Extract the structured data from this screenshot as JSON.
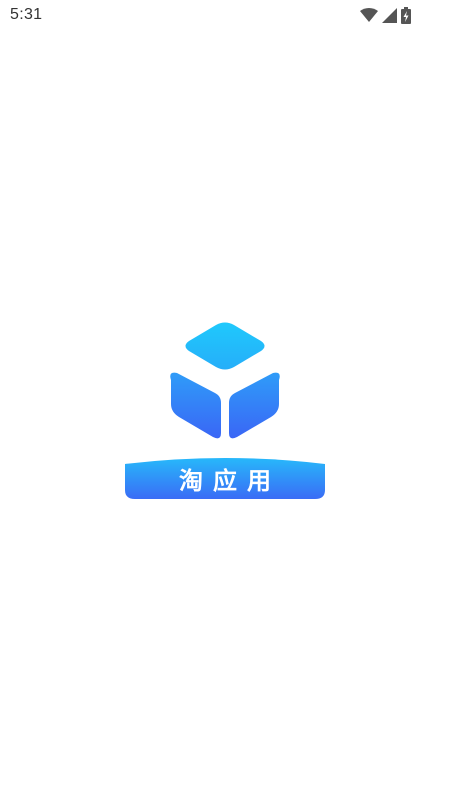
{
  "status_bar": {
    "time": "5:31",
    "icons": [
      "wifi-icon",
      "cell-signal-icon",
      "battery-charging-icon"
    ]
  },
  "splash": {
    "app_name": "淘应用",
    "colors": {
      "gradient_top": "#1fc3fb",
      "gradient_bottom": "#3a67f6",
      "text": "#ffffff",
      "background": "#ffffff"
    }
  }
}
